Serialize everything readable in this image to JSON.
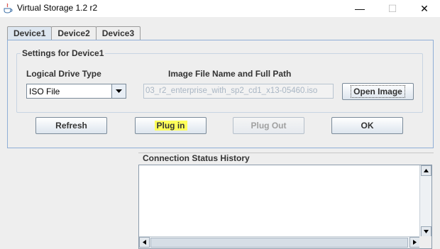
{
  "window": {
    "title": "Virtual Storage 1.2 r2",
    "minimize_glyph": "—",
    "maximize_glyph": "☐",
    "close_glyph": "✕"
  },
  "tabs": [
    {
      "label": "Device1",
      "active": true
    },
    {
      "label": "Device2",
      "active": false
    },
    {
      "label": "Device3",
      "active": false
    }
  ],
  "settings": {
    "group_title": "Settings for Device1",
    "drive_type_label": "Logical Drive Type",
    "drive_type_value": "ISO File",
    "image_path_label": "Image File Name and Full Path",
    "image_path_value": "03_r2_enterprise_with_sp2_cd1_x13-05460.iso",
    "open_image_label": "Open Image"
  },
  "actions": {
    "refresh_label": "Refresh",
    "plug_in_label": "Plug in",
    "plug_out_label": "Plug Out",
    "ok_label": "OK"
  },
  "status": {
    "title": "Connection Status History"
  },
  "icons": {
    "app": "java-cup-icon",
    "combo_arrow": "chevron-down-icon",
    "scroll_up": "arrow-up-icon",
    "scroll_down": "arrow-down-icon",
    "scroll_left": "arrow-left-icon",
    "scroll_right": "arrow-right-icon"
  },
  "colors": {
    "highlight": "#ffff5a",
    "active_tab": "#dde6f0",
    "panel_border": "#8faed6"
  }
}
